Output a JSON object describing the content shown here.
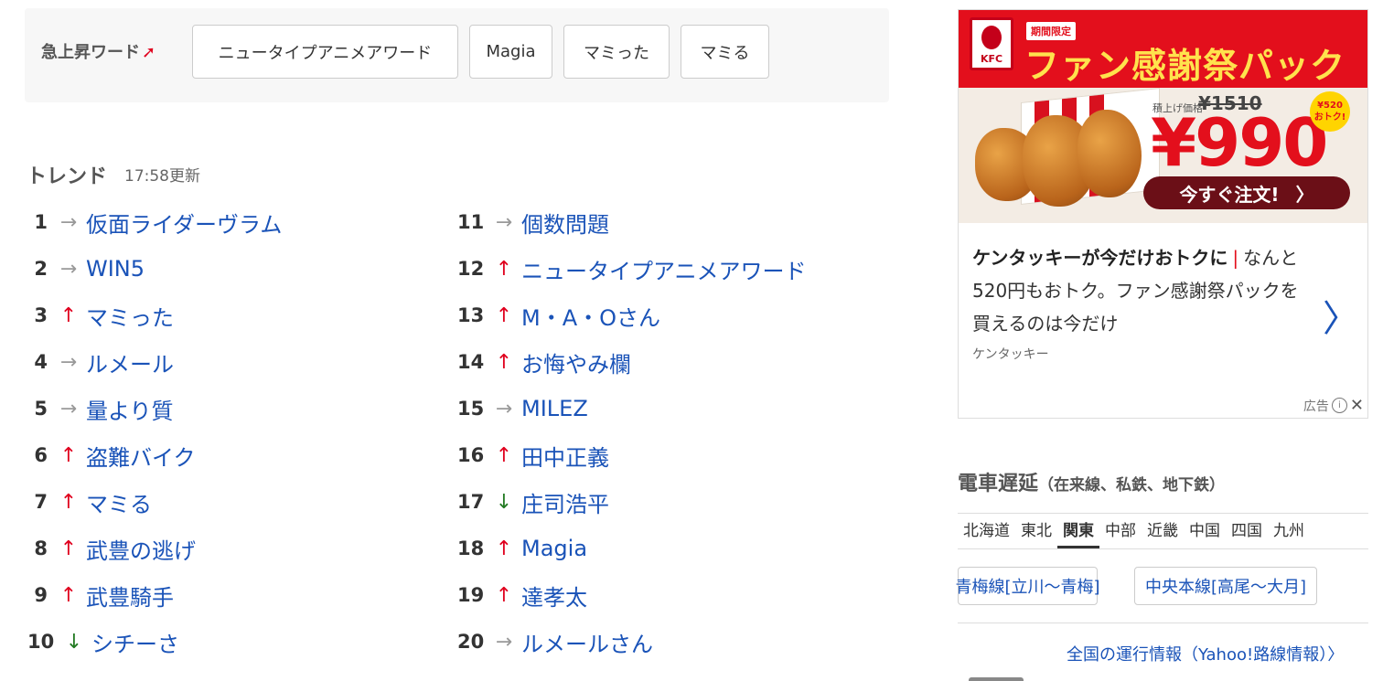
{
  "rising": {
    "label": "急上昇ワード",
    "arrow": "➚",
    "words": [
      "ニュータイプアニメアワード",
      "Magia",
      "マミった",
      "マミる"
    ]
  },
  "trend": {
    "title": "トレンド",
    "updated": "17:58更新",
    "items": [
      {
        "rank": "1",
        "trend": "flat",
        "arrow": "→",
        "word": "仮面ライダーヴラム"
      },
      {
        "rank": "2",
        "trend": "flat",
        "arrow": "→",
        "word": "WIN5"
      },
      {
        "rank": "3",
        "trend": "up",
        "arrow": "↑",
        "word": "マミった"
      },
      {
        "rank": "4",
        "trend": "flat",
        "arrow": "→",
        "word": "ルメール"
      },
      {
        "rank": "5",
        "trend": "flat",
        "arrow": "→",
        "word": "量より質"
      },
      {
        "rank": "6",
        "trend": "up",
        "arrow": "↑",
        "word": "盗難バイク"
      },
      {
        "rank": "7",
        "trend": "up",
        "arrow": "↑",
        "word": "マミる"
      },
      {
        "rank": "8",
        "trend": "up",
        "arrow": "↑",
        "word": "武豊の逃げ"
      },
      {
        "rank": "9",
        "trend": "up",
        "arrow": "↑",
        "word": "武豊騎手"
      },
      {
        "rank": "10",
        "trend": "down",
        "arrow": "↓",
        "word": "シチーさ"
      },
      {
        "rank": "11",
        "trend": "flat",
        "arrow": "→",
        "word": "個数問題"
      },
      {
        "rank": "12",
        "trend": "up",
        "arrow": "↑",
        "word": "ニュータイプアニメアワード"
      },
      {
        "rank": "13",
        "trend": "up",
        "arrow": "↑",
        "word": "M・A・Oさん"
      },
      {
        "rank": "14",
        "trend": "up",
        "arrow": "↑",
        "word": "お悔やみ欄"
      },
      {
        "rank": "15",
        "trend": "flat",
        "arrow": "→",
        "word": "MILEZ"
      },
      {
        "rank": "16",
        "trend": "up",
        "arrow": "↑",
        "word": "田中正義"
      },
      {
        "rank": "17",
        "trend": "down",
        "arrow": "↓",
        "word": "庄司浩平"
      },
      {
        "rank": "18",
        "trend": "up",
        "arrow": "↑",
        "word": "Magia"
      },
      {
        "rank": "19",
        "trend": "up",
        "arrow": "↑",
        "word": "達孝太"
      },
      {
        "rank": "20",
        "trend": "flat",
        "arrow": "→",
        "word": "ルメールさん"
      }
    ]
  },
  "ad": {
    "logo_text": "KFC",
    "limited_tag": "期間限定",
    "headline": "ファン感謝祭パック",
    "old_price_label": "積上げ価格",
    "old_price": "¥1510",
    "price": "¥990",
    "deal_badge_amount": "¥520",
    "deal_badge_text": "おトク!",
    "order_button": "今すぐ注文!",
    "order_chevron": "〉",
    "title_bold": "ケンタッキーが今だけおトクに",
    "title_sep": "|",
    "title_rest": "なんと520円もおトク。ファン感謝祭パックを買えるのは今だけ",
    "sponsor": "ケンタッキー",
    "chevron": "〉",
    "ad_label": "広告",
    "info_icon": "i",
    "close_icon": "✕"
  },
  "train": {
    "title": "電車遅延",
    "subtitle": "（在来線、私鉄、地下鉄）",
    "tabs": [
      "北海道",
      "東北",
      "関東",
      "中部",
      "近畿",
      "中国",
      "四国",
      "九州"
    ],
    "active_tab": "関東",
    "lines": [
      "青梅線[立川〜青梅]",
      "中央本線[高尾〜大月]"
    ],
    "national_link": "全国の運行情報（Yahoo!路線情報）〉"
  }
}
